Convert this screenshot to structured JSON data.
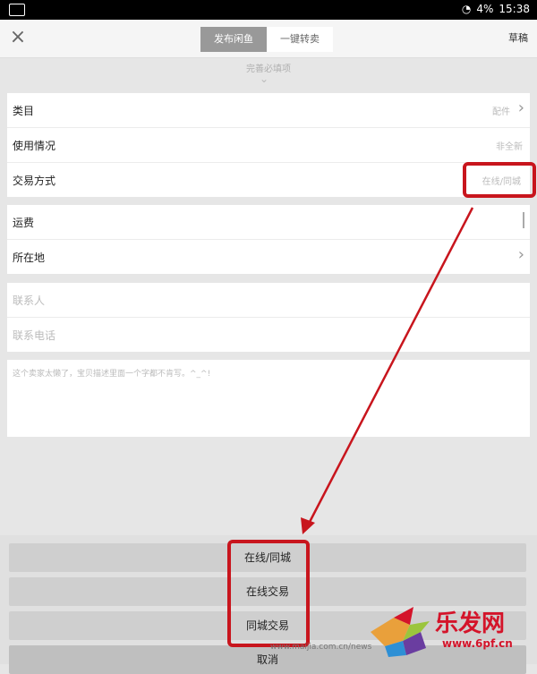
{
  "status_bar": {
    "battery": "4%",
    "time": "15:38"
  },
  "top_bar": {
    "close_label": "×",
    "tabs": [
      {
        "label": "发布闲鱼",
        "active": true
      },
      {
        "label": "一键转卖",
        "active": false
      }
    ],
    "draft_label": "草稿"
  },
  "form": {
    "hint": "完善必填项",
    "group1": [
      {
        "label": "类目",
        "value": "配件"
      },
      {
        "label": "使用情况",
        "value": "非全新"
      },
      {
        "label": "交易方式",
        "value": "在线/同城"
      }
    ],
    "group2": [
      {
        "label": "运费"
      },
      {
        "label": "所在地"
      }
    ],
    "group3": [
      {
        "placeholder": "联系人"
      },
      {
        "placeholder": "联系电话"
      }
    ],
    "description_placeholder": "这个卖家太懒了，宝贝描述里面一个字都不肯写。^_^!"
  },
  "action_sheet": {
    "options": [
      "在线/同城",
      "在线交易",
      "同城交易"
    ],
    "cancel_label": "取消"
  },
  "watermark": {
    "url_text": "www.maijia.com.cn/news",
    "logo_text": "乐发网",
    "logo_url": "www.6pf.cn"
  },
  "colors": {
    "highlight": "#c8151d",
    "active_tab": "#999999"
  }
}
